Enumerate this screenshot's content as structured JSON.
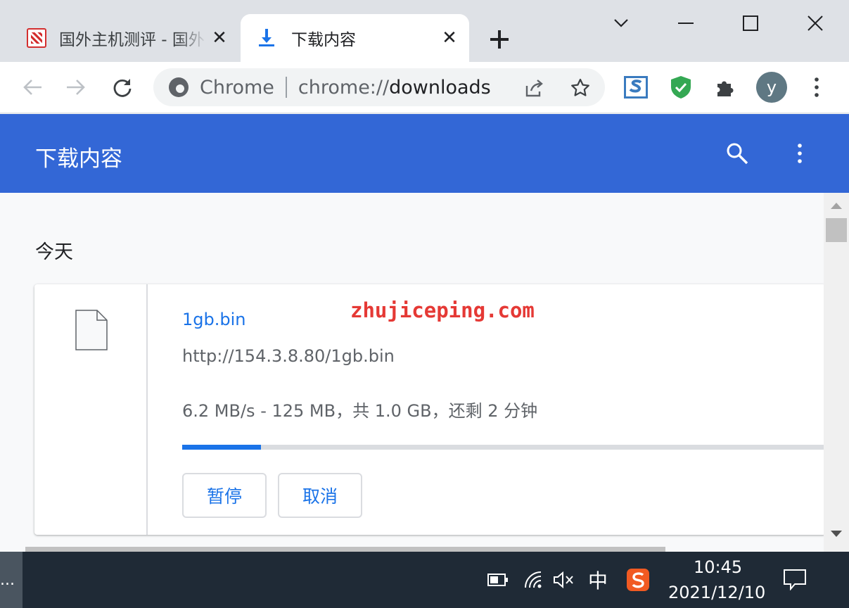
{
  "tabs": [
    {
      "title": "国外主机测评 - 国外",
      "active": false,
      "favicon": "site-seal-icon"
    },
    {
      "title": "下载内容",
      "active": true,
      "favicon": "download-arrow-icon"
    }
  ],
  "toolbar": {
    "omnibox_chip": "Chrome",
    "url_scheme": "chrome://",
    "url_path": "downloads",
    "avatar_letter": "y"
  },
  "page": {
    "title": "下载内容",
    "date_heading": "今天"
  },
  "download": {
    "file_name": "1gb.bin",
    "url": "http://154.3.8.80/1gb.bin",
    "status": "6.2 MB/s - 125 MB，共 1.0 GB，还剩 2 分钟",
    "progress": 0.122,
    "pause_label": "暂停",
    "cancel_label": "取消"
  },
  "watermark": "zhujiceping.com",
  "taskbar": {
    "left_label": "...",
    "ime_label": "中",
    "time": "10:45",
    "date": "2021/12/10"
  },
  "colors": {
    "header_blue": "#3367d6",
    "link_blue": "#1a73e8",
    "watermark_red": "#e53935",
    "shield_green": "#34a853"
  }
}
